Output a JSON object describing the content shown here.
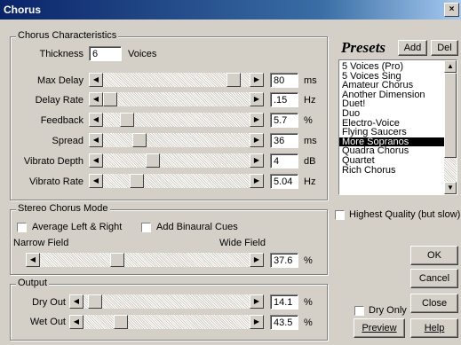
{
  "window": {
    "title": "Chorus",
    "close": "×"
  },
  "chorus": {
    "legend": "Chorus Characteristics",
    "thickness_label": "Thickness",
    "thickness_value": "6",
    "voices_label": "Voices",
    "sliders": [
      {
        "label": "Max Delay",
        "value": "80",
        "unit": "ms",
        "level": 0.93
      },
      {
        "label": "Delay Rate",
        "value": ".15",
        "unit": "Hz",
        "level": 0.0
      },
      {
        "label": "Feedback",
        "value": "5.7",
        "unit": "%",
        "level": 0.13
      },
      {
        "label": "Spread",
        "value": "36",
        "unit": "ms",
        "level": 0.22
      },
      {
        "label": "Vibrato Depth",
        "value": "4",
        "unit": "dB",
        "level": 0.32
      },
      {
        "label": "Vibrato Rate",
        "value": "5.04",
        "unit": "Hz",
        "level": 0.2
      }
    ]
  },
  "presets": {
    "title": "Presets",
    "add_label": "Add",
    "del_label": "Del",
    "items": [
      "5 Voices (Pro)",
      "5 Voices Sing",
      "Amateur Chorus",
      "Another Dimension",
      "Duet!",
      "Duo",
      "Electro-Voice",
      "Flying Saucers",
      "More Sopranos",
      "Quadra Chorus",
      "Quartet",
      "Rich Chorus"
    ],
    "selected": "More Sopranos"
  },
  "highest_quality_label": "Highest Quality (but slow)",
  "stereo": {
    "legend": "Stereo Chorus Mode",
    "average_label": "Average Left & Right",
    "binaural_label": "Add Binaural Cues",
    "narrow_label": "Narrow Field",
    "wide_label": "Wide Field",
    "value": "37.6",
    "unit": "%",
    "level": 0.36
  },
  "output": {
    "legend": "Output",
    "dry_label": "Dry Out",
    "dry_value": "14.1",
    "dry_unit": "%",
    "dry_level": 0.03,
    "wet_label": "Wet Out",
    "wet_value": "43.5",
    "wet_unit": "%",
    "wet_level": 0.2
  },
  "buttons": {
    "ok": "OK",
    "cancel": "Cancel",
    "close": "Close",
    "preview": "Preview",
    "help": "Help"
  },
  "dry_only_label": "Dry Only"
}
